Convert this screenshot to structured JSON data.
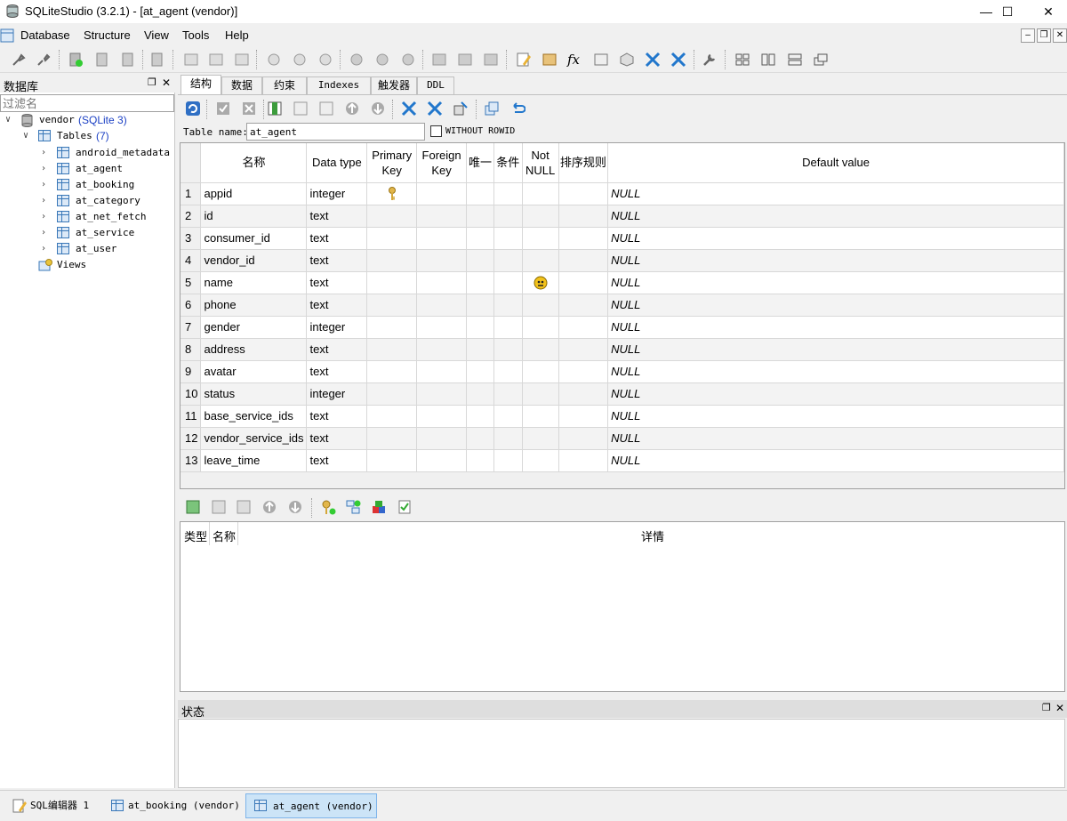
{
  "window": {
    "title": "SQLiteStudio (3.2.1) - [at_agent (vendor)]"
  },
  "menu": [
    "Database",
    "Structure",
    "View",
    "Tools",
    "Help"
  ],
  "db_panel": {
    "title": "数据库",
    "filter_placeholder": "过滤名",
    "database": {
      "name": "vendor",
      "type": "(SQLite 3)"
    },
    "tables_label": "Tables",
    "tables_count": "(7)",
    "tables": [
      "android_metadata",
      "at_agent",
      "at_booking",
      "at_category",
      "at_net_fetch",
      "at_service",
      "at_user"
    ],
    "views_label": "Views"
  },
  "editor": {
    "tabs": [
      "结构",
      "数据",
      "约束",
      "Indexes",
      "触发器",
      "DDL"
    ],
    "active_tab": "结构",
    "table_name_label": "Table name:",
    "table_name_value": "at_agent",
    "without_rowid_label": "WITHOUT ROWID",
    "columns_header": {
      "name": "名称",
      "data_type": "Data type",
      "primary_key": "Primary Key",
      "foreign_key": "Foreign Key",
      "unique": "唯一",
      "check": "条件",
      "not_null": "Not NULL",
      "collate": "排序规则",
      "default": "Default value"
    },
    "columns": [
      {
        "num": "1",
        "name": "appid",
        "type": "integer",
        "pk": true,
        "notnull": false,
        "default": "NULL"
      },
      {
        "num": "2",
        "name": "id",
        "type": "text",
        "pk": false,
        "notnull": false,
        "default": "NULL"
      },
      {
        "num": "3",
        "name": "consumer_id",
        "type": "text",
        "pk": false,
        "notnull": false,
        "default": "NULL"
      },
      {
        "num": "4",
        "name": "vendor_id",
        "type": "text",
        "pk": false,
        "notnull": false,
        "default": "NULL"
      },
      {
        "num": "5",
        "name": "name",
        "type": "text",
        "pk": false,
        "notnull": true,
        "default": "NULL"
      },
      {
        "num": "6",
        "name": "phone",
        "type": "text",
        "pk": false,
        "notnull": false,
        "default": "NULL"
      },
      {
        "num": "7",
        "name": "gender",
        "type": "integer",
        "pk": false,
        "notnull": false,
        "default": "NULL"
      },
      {
        "num": "8",
        "name": "address",
        "type": "text",
        "pk": false,
        "notnull": false,
        "default": "NULL"
      },
      {
        "num": "9",
        "name": "avatar",
        "type": "text",
        "pk": false,
        "notnull": false,
        "default": "NULL"
      },
      {
        "num": "10",
        "name": "status",
        "type": "integer",
        "pk": false,
        "notnull": false,
        "default": "NULL"
      },
      {
        "num": "11",
        "name": "base_service_ids",
        "type": "text",
        "pk": false,
        "notnull": false,
        "default": "NULL"
      },
      {
        "num": "12",
        "name": "vendor_service_ids",
        "type": "text",
        "pk": false,
        "notnull": false,
        "default": "NULL"
      },
      {
        "num": "13",
        "name": "leave_time",
        "type": "text",
        "pk": false,
        "notnull": false,
        "default": "NULL"
      }
    ],
    "constraints_header": {
      "type": "类型",
      "name": "名称",
      "details": "详情"
    }
  },
  "status_panel": {
    "title": "状态"
  },
  "taskbar": [
    {
      "label": "SQL编辑器 1",
      "active": false
    },
    {
      "label": "at_booking (vendor)",
      "active": false
    },
    {
      "label": "at_agent (vendor)",
      "active": true
    }
  ],
  "colors": {
    "selection": "#cce4f7",
    "link_blue": "#1a3fc4",
    "db_type_color": "#1a3fc4"
  }
}
